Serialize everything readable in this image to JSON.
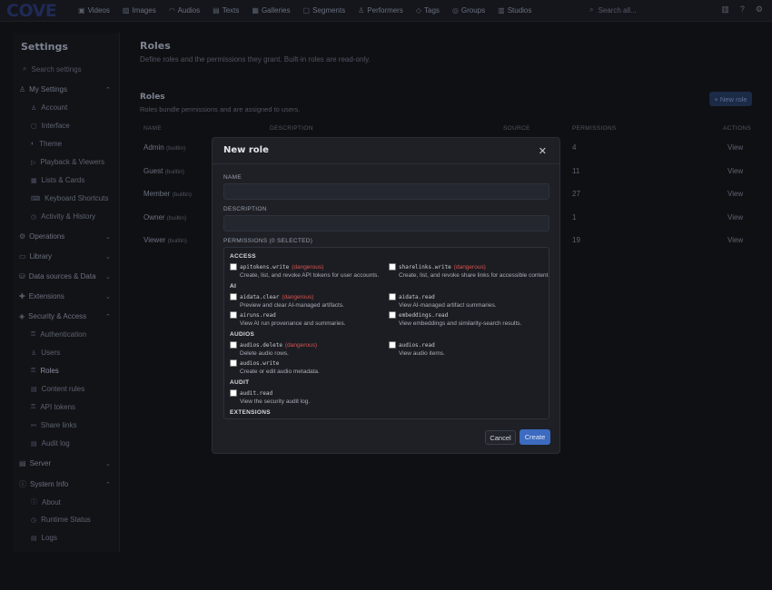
{
  "brand": "COVE",
  "nav": [
    {
      "icon": "video-icon",
      "glyph": "▣",
      "label": "Videos"
    },
    {
      "icon": "image-icon",
      "glyph": "▨",
      "label": "Images"
    },
    {
      "icon": "headphones-icon",
      "glyph": "◠",
      "label": "Audios"
    },
    {
      "icon": "text-icon",
      "glyph": "▤",
      "label": "Texts"
    },
    {
      "icon": "gallery-icon",
      "glyph": "▦",
      "label": "Galleries"
    },
    {
      "icon": "segment-icon",
      "glyph": "▢",
      "label": "Segments"
    },
    {
      "icon": "performer-icon",
      "glyph": "♙",
      "label": "Performers"
    },
    {
      "icon": "tag-icon",
      "glyph": "◇",
      "label": "Tags"
    },
    {
      "icon": "group-icon",
      "glyph": "◎",
      "label": "Groups"
    },
    {
      "icon": "studio-icon",
      "glyph": "▥",
      "label": "Studios"
    }
  ],
  "search": {
    "placeholder": "Search all..."
  },
  "sidebar": {
    "title": "Settings",
    "search_placeholder": "Search settings",
    "groups": [
      {
        "label": "My Settings",
        "icon": "user-icon",
        "expanded": true,
        "items": [
          "Account",
          "Interface",
          "Theme",
          "Playback & Viewers",
          "Lists & Cards",
          "Keyboard Shortcuts",
          "Activity & History"
        ]
      },
      {
        "label": "Operations",
        "icon": "gear-icon",
        "expanded": false,
        "items": []
      },
      {
        "label": "Library",
        "icon": "folder-icon",
        "expanded": false,
        "items": []
      },
      {
        "label": "Data sources & Data",
        "icon": "database-icon",
        "expanded": false,
        "items": []
      },
      {
        "label": "Extensions",
        "icon": "puzzle-icon",
        "expanded": false,
        "items": []
      },
      {
        "label": "Security & Access",
        "icon": "shield-icon",
        "expanded": true,
        "items": [
          "Authentication",
          "Users",
          "Roles",
          "Content rules",
          "API tokens",
          "Share links",
          "Audit log"
        ]
      },
      {
        "label": "Server",
        "icon": "server-icon",
        "expanded": false,
        "items": []
      },
      {
        "label": "System Info",
        "icon": "info-icon",
        "expanded": true,
        "items": [
          "About",
          "Runtime Status",
          "Logs"
        ]
      }
    ]
  },
  "page": {
    "title": "Roles",
    "subtitle": "Define roles and the permissions they grant. Built-in roles are read-only."
  },
  "panel": {
    "title": "Roles",
    "subtitle": "Roles bundle permissions and are assigned to users.",
    "new_button": "+ New role",
    "columns": [
      "NAME",
      "DESCRIPTION",
      "SOURCE",
      "PERMISSIONS",
      "ACTIONS"
    ],
    "rows": [
      {
        "name": "Admin",
        "badge": "(builtin)",
        "permissions": "4",
        "action": "View"
      },
      {
        "name": "Guest",
        "badge": "(builtin)",
        "permissions": "11",
        "action": "View"
      },
      {
        "name": "Member",
        "badge": "(builtin)",
        "permissions": "27",
        "action": "View"
      },
      {
        "name": "Owner",
        "badge": "(builtin)",
        "permissions": "1",
        "action": "View"
      },
      {
        "name": "Viewer",
        "badge": "(builtin)",
        "permissions": "19",
        "action": "View"
      }
    ]
  },
  "modal": {
    "title": "New role",
    "name_label": "NAME",
    "name_value": "",
    "description_label": "DESCRIPTION",
    "description_value": "",
    "permissions_label": "PERMISSIONS (0 SELECTED)",
    "sections": [
      {
        "title": "ACCESS",
        "perms": [
          {
            "code": "apitokens.write",
            "danger": "(dangerous)",
            "desc": "Create, list, and revoke API tokens for user accounts."
          },
          {
            "code": "sharelinks.write",
            "danger": "(dangerous)",
            "desc": "Create, list, and revoke share links for accessible content."
          }
        ]
      },
      {
        "title": "AI",
        "perms": [
          {
            "code": "aidata.clear",
            "danger": "(dangerous)",
            "desc": "Preview and clear AI-managed artifacts."
          },
          {
            "code": "aidata.read",
            "danger": "",
            "desc": "View AI-managed artifact summaries."
          },
          {
            "code": "airuns.read",
            "danger": "",
            "desc": "View AI run provenance and summaries."
          },
          {
            "code": "embeddings.read",
            "danger": "",
            "desc": "View embeddings and similarity-search results."
          }
        ]
      },
      {
        "title": "AUDIOS",
        "perms": [
          {
            "code": "audios.delete",
            "danger": "(dangerous)",
            "desc": "Delete audio rows."
          },
          {
            "code": "audios.read",
            "danger": "",
            "desc": "View audio items."
          },
          {
            "code": "audios.write",
            "danger": "",
            "desc": "Create or edit audio metadata."
          }
        ]
      },
      {
        "title": "AUDIT",
        "perms": [
          {
            "code": "audit.read",
            "danger": "",
            "desc": "View the security audit log."
          }
        ]
      },
      {
        "title": "EXTENSIONS",
        "perms": []
      }
    ],
    "cancel_label": "Cancel",
    "create_label": "Create",
    "accent": "#3c6bc0",
    "danger_color": "#d9534f"
  }
}
